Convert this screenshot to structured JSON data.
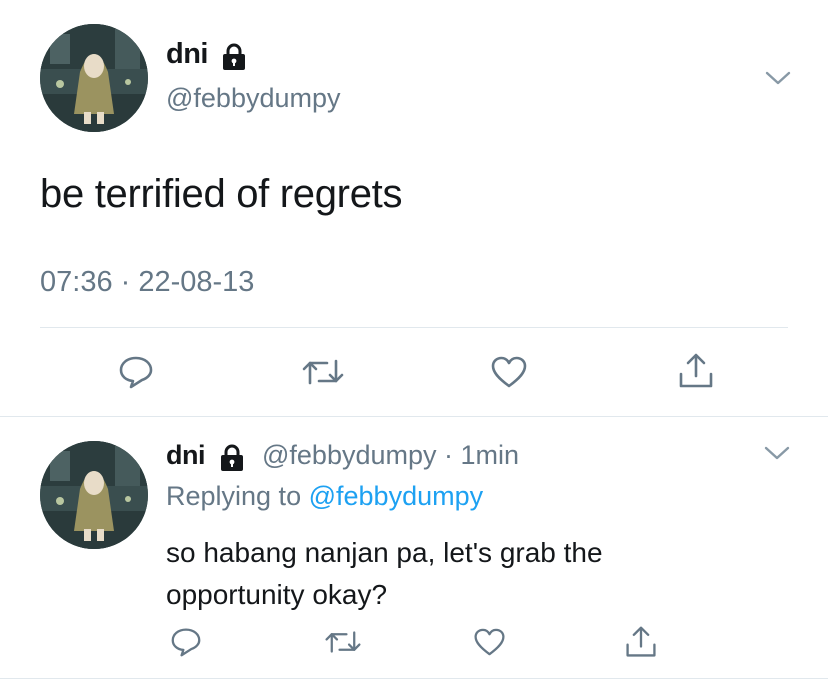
{
  "main_tweet": {
    "display_name": "dni",
    "handle": "@febbydumpy",
    "text": "be terrified of regrets",
    "timestamp": "07:36 · 22-08-13",
    "icons": [
      "lock-icon",
      "chevron-down-icon",
      "reply-icon",
      "retweet-icon",
      "like-icon",
      "share-icon"
    ]
  },
  "reply_tweet": {
    "display_name": "dni",
    "handle_time": "@febbydumpy · 1min",
    "replying_prefix": "Replying to",
    "replying_to": "@febbydumpy",
    "text_line1": "so habang nanjan pa, let's grab the",
    "text_line2": "opportunity okay?"
  },
  "colors": {
    "text": "#14171a",
    "secondary": "#657786",
    "link": "#1da1f2",
    "divider": "#e1e8ed",
    "icon": "#657786"
  }
}
